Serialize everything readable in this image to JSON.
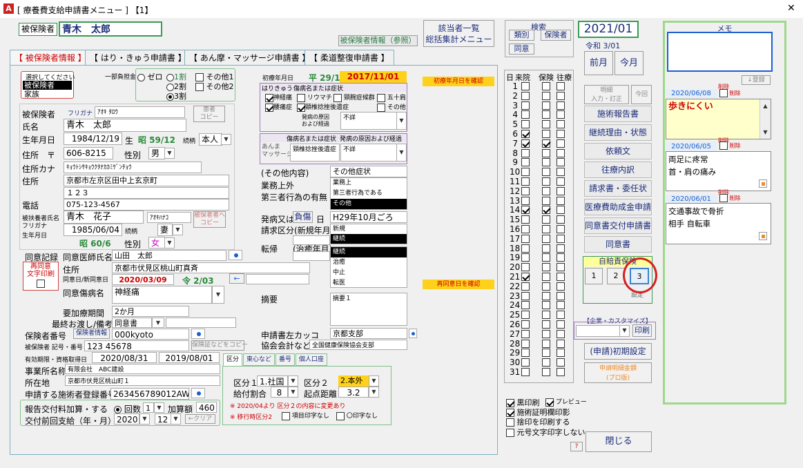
{
  "window": {
    "title": "[ 療養費支給申請書メニュー  ]  【1】",
    "icon": "A",
    "close": "✕"
  },
  "patient": {
    "label": "被保険者",
    "name": "青木　太郎",
    "info_btn": "被保険者情報（参照）"
  },
  "top_right": {
    "list_btn": "該当者一覧\n総括集計メニュー",
    "search_title": "検索",
    "search_btns": [
      "類別",
      "保険者",
      "同意"
    ],
    "year": "2021/01",
    "reiwa": "令和 3/01",
    "prev": "前月",
    "curr": "今月"
  },
  "tabs": [
    "【 被保険者情報 】",
    "【 はり・きゅう申請書 】",
    "【 あん摩・マッサージ申請書 】",
    "【 柔道整復申請書 】"
  ],
  "select_header": "選択してください",
  "select_items": [
    "被保険者",
    "家族"
  ],
  "burden": {
    "label": "一部負担金",
    "opts": [
      "ゼロ",
      "1割",
      "2割",
      "3割"
    ],
    "other": [
      "その他1",
      "その他2"
    ]
  },
  "insured": {
    "labels": [
      "被保険者",
      "氏名",
      "生年月日",
      "住所　〒",
      "住所カナ",
      "住所",
      "電話",
      "被扶養者氏名",
      "フリガナ",
      "生年月日"
    ],
    "furigana_lbl": "フリガナ",
    "furigana": "ｱｵｷ ﾀﾛｳ",
    "kanja": "患者\nコピー",
    "name": "青木　太郎",
    "birth": "1984/12/19",
    "sei": "生",
    "era": "昭 59/12",
    "zokugara_lbl": "続柄",
    "zokugara": "本人",
    "zip": "606-8215",
    "sex_lbl": "性別",
    "sex": "男",
    "kana_addr": "ｷｮｳﾄｼｻｷｮｳｸﾀﾅｶｶﾐｹﾞﾝﾁｮｳ",
    "addr": "京都市左京区田中上玄京町",
    "addr2": "１２３",
    "tel": "075-123-4567",
    "dep_name": "青木　花子",
    "dep_kana": "ｱｵｷﾊﾅｺ",
    "dep_copy": "被保者者へ\nコピー",
    "dep_birth": "1985/06/04",
    "dep_era": "昭 60/6",
    "dep_rel": "妻",
    "dep_sex": "女"
  },
  "first": {
    "label": "初療年月日",
    "era": "平 29/11",
    "date": "2017/11/01",
    "note": "初療年月日を確認"
  },
  "hari": {
    "title": "はりきゅう",
    "sub": "傷病名または症状",
    "items": [
      "神経痛",
      "リウマチ",
      "頸腕症候群",
      "五十肩",
      "腰痛症",
      "頸椎捻挫後遺症",
      "その他"
    ],
    "cause_lbl": "発病の原因\nおよび経過",
    "cause": "不詳"
  },
  "anma": {
    "lbl": "あんま\nマッサージ",
    "sub1": "傷病名または症状",
    "sub2": "発病の原因および経過",
    "disease": "頸椎捻挫後遺症",
    "cause": "不詳"
  },
  "mid": {
    "other_lbl": "(その他内容)",
    "other_val": "その他症状",
    "work_lbl": "業務上外",
    "third_lbl": "第三者行為の有無",
    "list1": [
      "業務上",
      "第三者行為である",
      "その他"
    ],
    "onset_lbl": "発病又は",
    "onset_btn": "負傷",
    "onset_day": "日",
    "onset": "H29年10月ごろ",
    "claim_lbl": "請求区分(新規年月)",
    "list2": [
      "新規",
      "継続"
    ],
    "tenki_lbl": "転帰",
    "heal_lbl": "(治癒年月)",
    "list3": [
      "継続",
      "治癒",
      "中止",
      "転医"
    ],
    "tekiyo_lbl": "摘要",
    "tekiyo": "摘要１",
    "kakko_lbl": "申請書左カッコ",
    "kakko": "京都支部",
    "kyokai_lbl": "協会会計など",
    "kyokai": "全国健康保険協会支部"
  },
  "doui": {
    "lbl": "同意記録",
    "doctor_lbl": "同意医師氏名",
    "doctor": "山田　太郎",
    "reconsent": "再同意\n文字印刷",
    "addr_lbl": "住所",
    "addr": "京都市伏見区桃山町真斉",
    "date_lbl": "同意日/新同意日",
    "date": "2020/03/09",
    "era": "令 2/03",
    "arrow": "←",
    "note": "再同意日を確認",
    "disease_lbl": "同意傷病名",
    "disease": "神経痛"
  },
  "lower": {
    "period_lbl": "要加療期間",
    "period": "2か月",
    "last_lbl": "最終お渡し/備考",
    "last": "同意書",
    "ins_lbl": "保険者番号",
    "ins_btn": "保険者情報",
    "ins": "000kyoto",
    "symbol_lbl": "被保険者 記号・番号",
    "symbol": "123 45678",
    "copy_btn": "保険証などをコピー",
    "valid_lbl": "有効期限・資格取得日",
    "valid1": "2020/08/31",
    "valid2": "2019/08/01",
    "office_lbl": "事業所名称",
    "office": "有限会社　ABC建設",
    "loc_lbl": "所在地",
    "loc": "京都市伏見区桃山町１",
    "reg_lbl": "申請する施術者登録番号",
    "reg": "263456789012AW"
  },
  "report": {
    "lbl1": "報告交付料加算・する",
    "count_lbl": "回数",
    "count": "1",
    "add_lbl": "加算額",
    "add": "460",
    "lbl2": "交付前回支給（年・月）",
    "year": "2020",
    "month": "12",
    "clear": "←クリア"
  },
  "kubun": {
    "tabs": [
      "区分",
      "東心など",
      "番号",
      "個人口座"
    ],
    "k1_lbl": "区分１",
    "k1": "1.社国",
    "k2_lbl": "区分２",
    "k2": "2.本外",
    "rate_lbl": "給付割合",
    "rate": "8",
    "dist_lbl": "起点距離",
    "dist": "3.2",
    "note1": "※ 2020/04より 区分２の内容に変更あり",
    "note2": "※ 移行時区分2",
    "opt1": "項目印字なし",
    "opt2": "〇印字なし"
  },
  "days": {
    "h1": "日",
    "h2": "来院",
    "h3": "保険",
    "h4": "往療",
    "rai": [
      6,
      7,
      14,
      21
    ],
    "hoken": [
      7,
      14
    ]
  },
  "actions": {
    "meisai": "明細\n入力・訂正",
    "konkai": "今回",
    "btns": [
      "施術報告書",
      "継続理由・状態",
      "依頼文",
      "往療内訳",
      "請求書・委任状",
      "医療費助成金申請",
      "同意書交付申請書",
      "同意書"
    ],
    "jibai": "自賠責保険",
    "jibai_btns": [
      "1",
      "2",
      "3"
    ],
    "tooltip": "設定",
    "kigyo": "【企業・カスタマイズ】",
    "print": "印刷",
    "init": "(申請)初期設定",
    "pro": "申請明細金額\n(プロ版)"
  },
  "printopts": {
    "items": [
      "黒印刷",
      "施術証明欄印影",
      "捨印を印刷する",
      "元号文字印字しない"
    ],
    "preview": "プレビュー"
  },
  "close_btn": "閉じる",
  "help": "?",
  "memo": {
    "title": "メモ",
    "reg": "↓登録",
    "del": "削除",
    "entries": [
      {
        "date": "2020/06/08",
        "text": "歩きにくい"
      },
      {
        "date": "2020/06/05",
        "text": "両足に疼常\n首・肩の痛み"
      },
      {
        "date": "2020/06/01",
        "text": "交通事故で骨折\n相手 自転車"
      }
    ]
  }
}
